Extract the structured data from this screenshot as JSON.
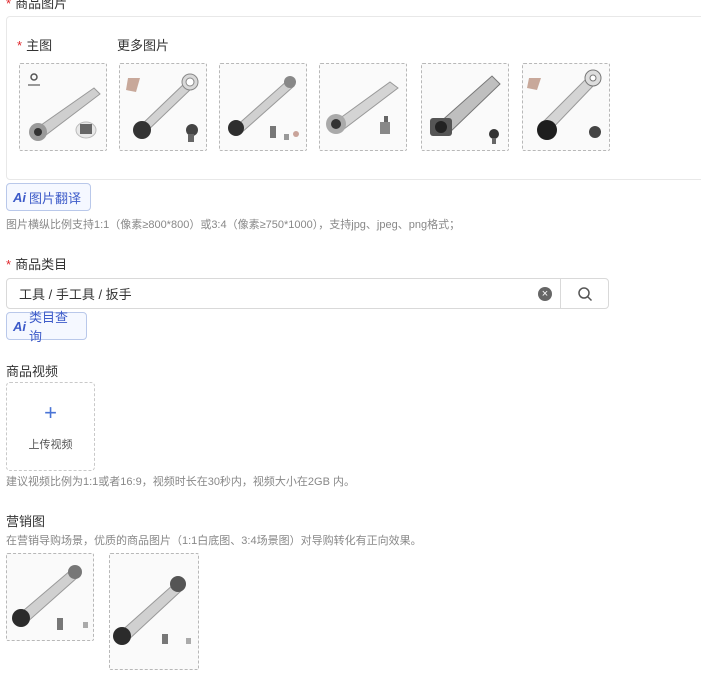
{
  "product_images": {
    "title": "商品图片",
    "main_label": "主图",
    "more_label": "更多图片",
    "thumbnails": [
      {
        "name": "thumb-main"
      },
      {
        "name": "thumb-more-1"
      },
      {
        "name": "thumb-more-2"
      },
      {
        "name": "thumb-more-3"
      },
      {
        "name": "thumb-more-4"
      },
      {
        "name": "thumb-more-5"
      }
    ],
    "ai_button_label": "图片翻译",
    "hint": "图片横纵比例支持1:1（像素≥800*800）或3:4（像素≥750*1000），支持jpg、jpeg、png格式；"
  },
  "category": {
    "title": "商品类目",
    "value": "工具 / 手工具 / 扳手",
    "ai_button_label": "类目查询"
  },
  "video": {
    "title": "商品视频",
    "upload_label": "上传视频",
    "hint": "建议视频比例为1:1或者16:9，视频时长在30秒内，视频大小在2GB 内。"
  },
  "marketing": {
    "title": "营销图",
    "hint": "在营销导购场景，优质的商品图片（1:1白底图、3:4场景图）对导购转化有正向效果。"
  },
  "ai_prefix": "Ai",
  "required_mark": "*",
  "colors": {
    "accent": "#3d5bc9",
    "required": "#e0262b",
    "hint": "#888888"
  }
}
